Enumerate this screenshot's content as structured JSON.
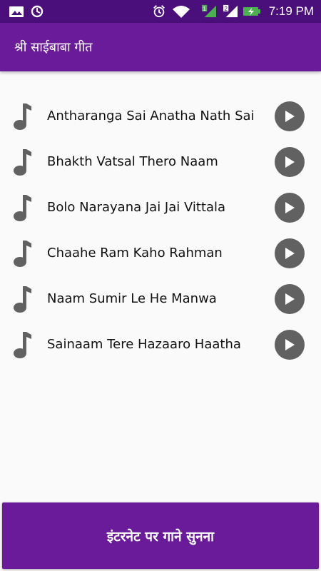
{
  "status_bar": {
    "time": "7:19 PM",
    "icons": [
      "image-icon",
      "sync-icon",
      "alarm-icon",
      "wifi-icon",
      "signal-sim1-icon",
      "signal-sim2-icon",
      "battery-charging-icon"
    ],
    "sim1_label": "1",
    "sim2_label": "2"
  },
  "app_bar": {
    "title": "श्री साईबाबा गीत",
    "color": "#6a1b9a"
  },
  "songs": [
    {
      "title": "Antharanga Sai Anatha Nath Sai"
    },
    {
      "title": "Bhakth Vatsal Thero Naam"
    },
    {
      "title": "Bolo Narayana Jai Jai Vittala"
    },
    {
      "title": "Chaahe Ram Kaho Rahman"
    },
    {
      "title": "Naam Sumir Le He Manwa"
    },
    {
      "title": "Sainaam Tere Hazaaro Haatha"
    }
  ],
  "bottom_button": {
    "label": "इंटरनेट पर गाने सुनना"
  }
}
